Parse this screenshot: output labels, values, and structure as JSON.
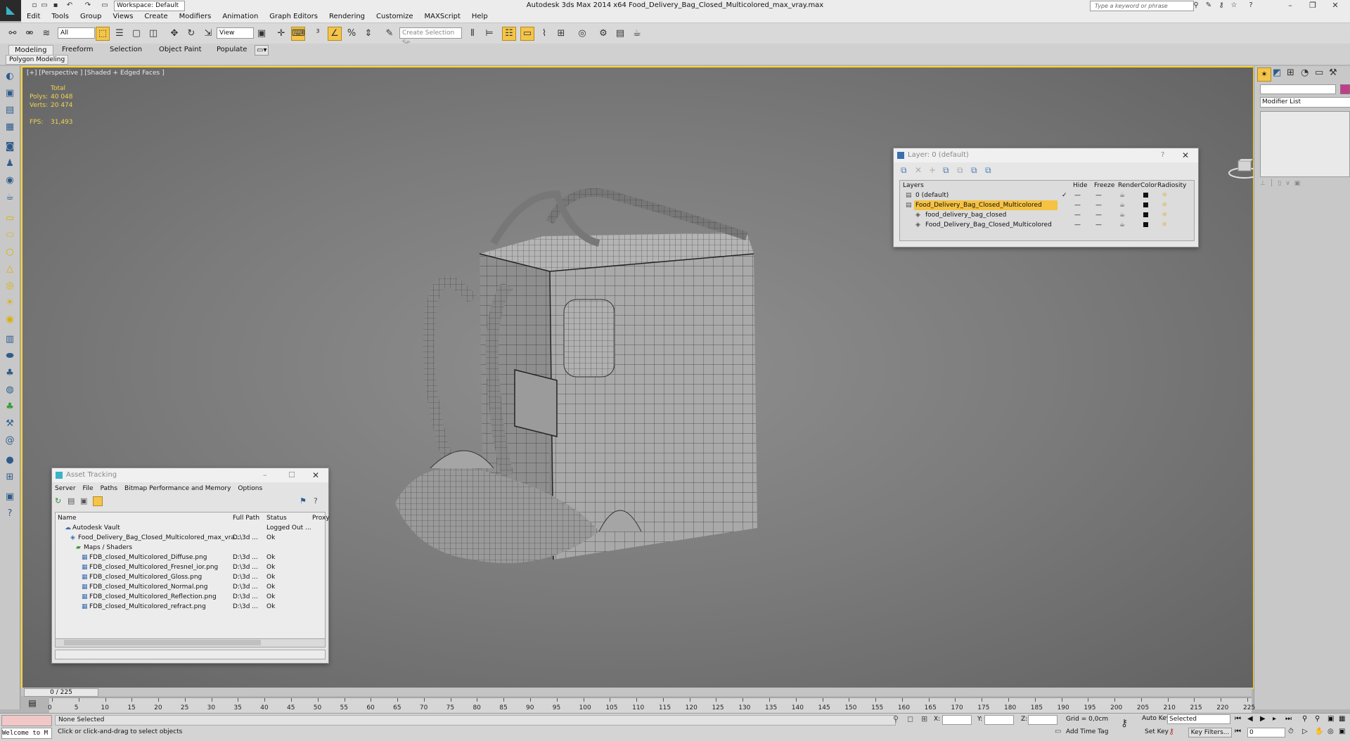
{
  "window": {
    "title": "Autodesk 3ds Max  2014 x64     Food_Delivery_Bag_Closed_Multicolored_max_vray.max",
    "workspace": "Workspace: Default",
    "search_placeholder": "Type a keyword or phrase"
  },
  "menu": [
    "Edit",
    "Tools",
    "Group",
    "Views",
    "Create",
    "Modifiers",
    "Animation",
    "Graph Editors",
    "Rendering",
    "Customize",
    "MAXScript",
    "Help"
  ],
  "toolbar": {
    "filter_value": "All",
    "refcoord_value": "View",
    "selection_set_placeholder": "Create Selection Se"
  },
  "ribbon": {
    "tabs": [
      "Modeling",
      "Freeform",
      "Selection",
      "Object Paint",
      "Populate"
    ],
    "active_tab": "Modeling",
    "sub_tab": "Polygon Modeling"
  },
  "viewport": {
    "label": "[+] [Perspective ] [Shaded + Edged Faces ]",
    "stats_header": "Total",
    "polys_label": "Polys:",
    "polys_value": "40 048",
    "verts_label": "Verts:",
    "verts_value": "20 474",
    "fps_label": "FPS:",
    "fps_value": "31,493"
  },
  "layer_dialog": {
    "title": "Layer: 0 (default)",
    "columns": [
      "Layers",
      "Hide",
      "Freeze",
      "Render",
      "Color",
      "Radiosity"
    ],
    "rows": [
      {
        "name": "0 (default)",
        "indent": 0,
        "check": "✓",
        "selected": false
      },
      {
        "name": "Food_Delivery_Bag_Closed_Multicolored",
        "indent": 0,
        "check": "",
        "selected": true
      },
      {
        "name": "food_delivery_bag_closed",
        "indent": 1,
        "check": "",
        "selected": false
      },
      {
        "name": "Food_Delivery_Bag_Closed_Multicolored",
        "indent": 1,
        "check": "",
        "selected": false
      }
    ]
  },
  "right_panel": {
    "modifier_list": "Modifier List"
  },
  "asset_tracking": {
    "title": "Asset Tracking",
    "menu": [
      "Server",
      "File",
      "Paths",
      "Bitmap Performance and Memory",
      "Options"
    ],
    "columns": [
      "Name",
      "Full Path",
      "Status",
      "Proxy"
    ],
    "rows": [
      {
        "name": "Autodesk Vault",
        "path": "",
        "status": "Logged Out ...",
        "indent": 1
      },
      {
        "name": "Food_Delivery_Bag_Closed_Multicolored_max_vra...",
        "path": "D:\\3d ...",
        "status": "Ok",
        "indent": 2
      },
      {
        "name": "Maps / Shaders",
        "path": "",
        "status": "",
        "indent": 3
      },
      {
        "name": "FDB_closed_Multicolored_Diffuse.png",
        "path": "D:\\3d ...",
        "status": "Ok",
        "indent": 4
      },
      {
        "name": "FDB_closed_Multicolored_Fresnel_ior.png",
        "path": "D:\\3d ...",
        "status": "Ok",
        "indent": 4
      },
      {
        "name": "FDB_closed_Multicolored_Gloss.png",
        "path": "D:\\3d ...",
        "status": "Ok",
        "indent": 4
      },
      {
        "name": "FDB_closed_Multicolored_Normal.png",
        "path": "D:\\3d ...",
        "status": "Ok",
        "indent": 4
      },
      {
        "name": "FDB_closed_Multicolored_Reflection.png",
        "path": "D:\\3d ...",
        "status": "Ok",
        "indent": 4
      },
      {
        "name": "FDB_closed_Multicolored_refract.png",
        "path": "D:\\3d ...",
        "status": "Ok",
        "indent": 4
      }
    ]
  },
  "timeline": {
    "slider_label": "0 / 225",
    "ticks": [
      "0",
      "5",
      "10",
      "15",
      "20",
      "25",
      "30",
      "35",
      "40",
      "45",
      "50",
      "55",
      "60",
      "65",
      "70",
      "75",
      "80",
      "85",
      "90",
      "95",
      "100",
      "105",
      "110",
      "115",
      "120",
      "125",
      "130",
      "135",
      "140",
      "145",
      "150",
      "155",
      "160",
      "165",
      "170",
      "175",
      "180",
      "185",
      "190",
      "195",
      "200",
      "205",
      "210",
      "215",
      "220",
      "225"
    ]
  },
  "status": {
    "welcome": "Welcome to M",
    "selection": "None Selected",
    "prompt": "Click or click-and-drag to select objects",
    "x_label": "X:",
    "y_label": "Y:",
    "z_label": "Z:",
    "grid": "Grid = 0,0cm",
    "add_time_tag": "Add Time Tag",
    "auto_key": "Auto Key",
    "set_key": "Set Key",
    "selected_dropdown": "Selected",
    "key_filters": "Key Filters...",
    "frame_value": "0"
  },
  "colors": {
    "accent": "#ffd325",
    "highlight": "#f5c242",
    "viewport_bg": "#7b7b7b"
  }
}
